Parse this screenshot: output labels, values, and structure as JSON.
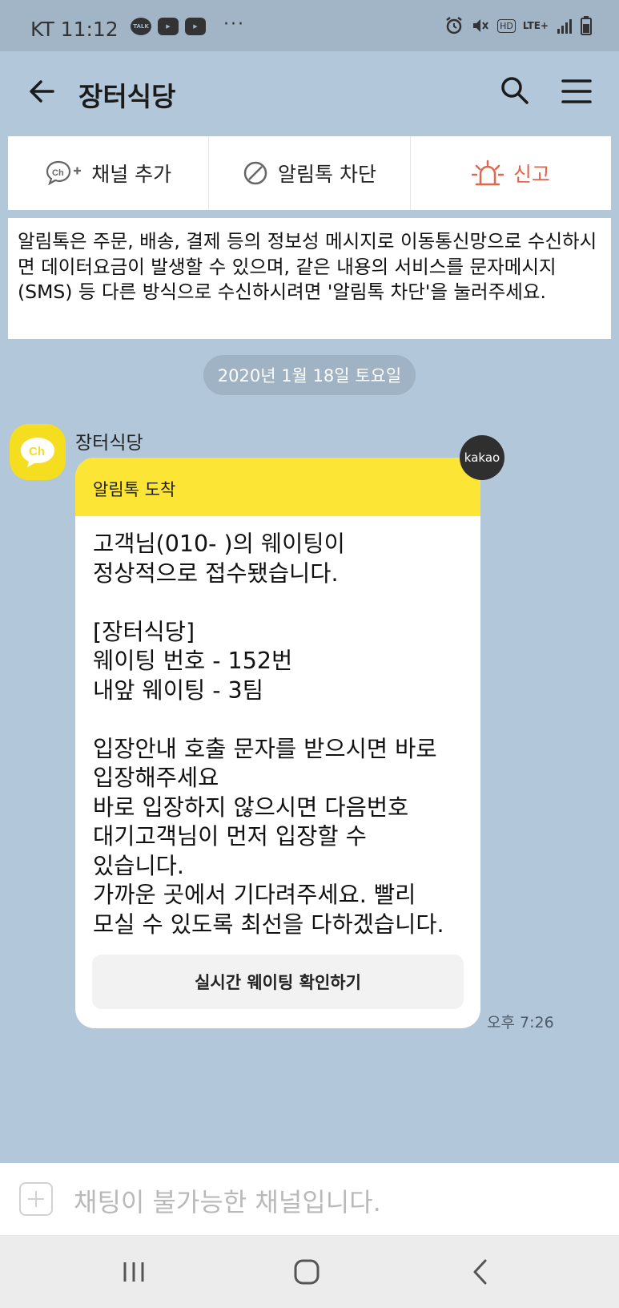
{
  "status_bar": {
    "carrier_time": "KT 11:12",
    "notif_icons": [
      "talk-icon",
      "youtube-icon",
      "youtube-icon"
    ],
    "more": "···",
    "hd": "HD",
    "network": "LTE+"
  },
  "header": {
    "title": "장터식당"
  },
  "actions": {
    "add_channel": "채널 추가",
    "block": "알림톡 차단",
    "report": "신고",
    "report_color": "#e0674f"
  },
  "notice": {
    "text": "알림톡은 주문, 배송, 결제 등의 정보성 메시지로 이동통신망으로 수신하시면 데이터요금이 발생할 수 있으며, 같은 내용의 서비스를 문자메시지(SMS) 등 다른 방식으로 수신하시려면 '알림톡 차단'을 눌러주세요."
  },
  "chat": {
    "date": "2020년 1월 18일 토요일",
    "sender": "장터식당",
    "avatar_label": "Ch",
    "badge": "kakao",
    "header": "알림톡 도착",
    "message": "고객님(010-                 )의 웨이팅이\n정상적으로 접수됐습니다.\n\n[장터식당]\n웨이팅 번호 - 152번\n내앞 웨이팅 - 3팀\n\n입장안내 호출 문자를 받으시면 바로\n입장해주세요\n바로 입장하지 않으시면 다음번호\n대기고객님이 먼저 입장할 수\n있습니다.\n가까운 곳에서 기다려주세요. 빨리\n모실 수 있도록 최선을 다하겠습니다.",
    "button": "실시간 웨이팅 확인하기",
    "time": "오후 7:26",
    "header_color": "#fde536"
  },
  "input": {
    "placeholder": "채팅이 불가능한 채널입니다."
  }
}
